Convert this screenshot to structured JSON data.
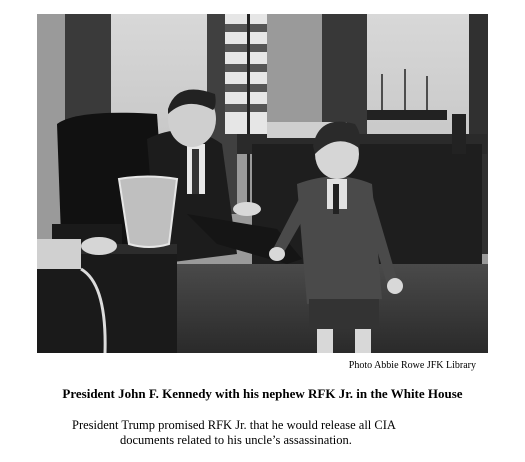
{
  "photo": {
    "credit": "Photo Abbie Rowe JFK Library"
  },
  "caption": "President John F. Kennedy with his nephew RFK Jr. in the White House",
  "body": {
    "line1": "President Trump promised RFK Jr. that he would release all CIA",
    "line2": "documents related to his uncle’s assassination."
  }
}
